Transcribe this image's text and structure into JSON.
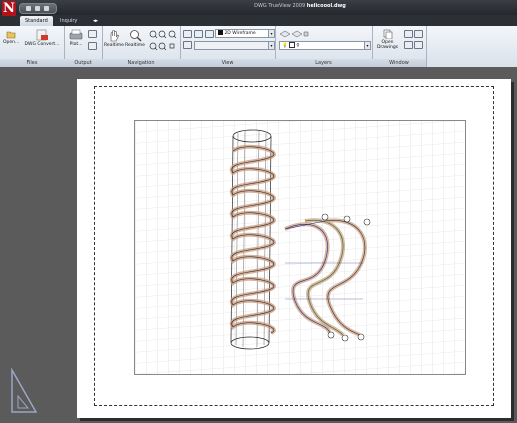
{
  "app": {
    "logo_letter": "N"
  },
  "window": {
    "title_prefix": "DWG TrueView 2009",
    "file_name": "helicoool.dwg"
  },
  "tabs": [
    {
      "label": "Standard",
      "active": true
    },
    {
      "label": "Inquiry",
      "active": false
    }
  ],
  "ribbon": {
    "files": {
      "label": "Files",
      "open": "Open...",
      "dwg_convert": "DWG Convert..."
    },
    "output": {
      "label": "Output",
      "plot": "Plot..."
    },
    "navigation": {
      "label": "Navigation",
      "realtime_pan": "Realtime",
      "realtime_zoom": "Realtime"
    },
    "view": {
      "label": "View",
      "visual_style": "2D Wireframe",
      "named_view": ""
    },
    "layers": {
      "label": "Layers",
      "current_layer": "0"
    },
    "window": {
      "label": "Window",
      "open_drawings": "Open Drawings"
    }
  },
  "colors": {
    "titlebar": "#2b2e33",
    "ribbon": "#e4eaf1",
    "workspace": "#5b5b5b",
    "paper": "#ffffff",
    "helix_shadow": "#c99a7e",
    "accent_red": "#b3121a"
  },
  "icons": [
    "open-icon",
    "dwg-convert-icon",
    "plot-icon",
    "pan-icon",
    "zoom-icon",
    "layers-icon",
    "open-drawings-icon",
    "ucs-icon"
  ]
}
